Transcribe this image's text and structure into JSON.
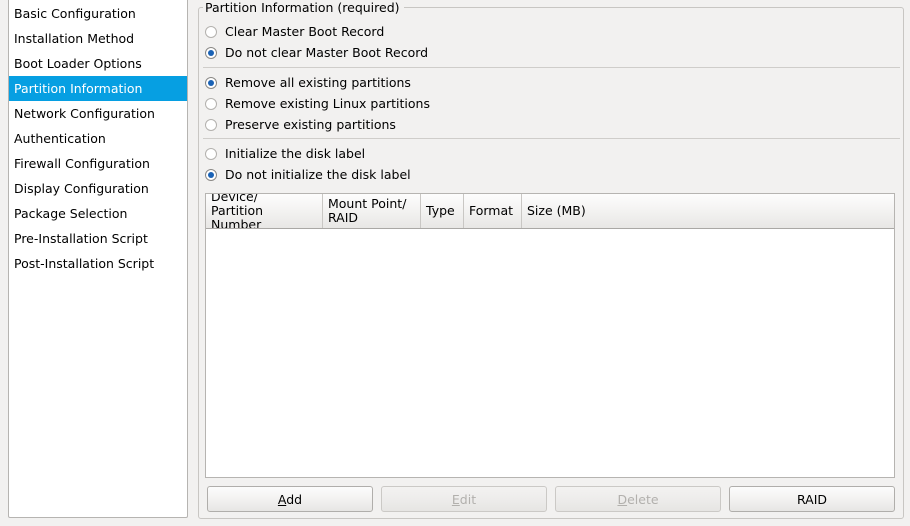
{
  "sidebar": {
    "items": [
      {
        "label": "Basic Configuration",
        "selected": false
      },
      {
        "label": "Installation Method",
        "selected": false
      },
      {
        "label": "Boot Loader Options",
        "selected": false
      },
      {
        "label": "Partition Information",
        "selected": true
      },
      {
        "label": "Network Configuration",
        "selected": false
      },
      {
        "label": "Authentication",
        "selected": false
      },
      {
        "label": "Firewall Configuration",
        "selected": false
      },
      {
        "label": "Display Configuration",
        "selected": false
      },
      {
        "label": "Package Selection",
        "selected": false
      },
      {
        "label": "Pre-Installation Script",
        "selected": false
      },
      {
        "label": "Post-Installation Script",
        "selected": false
      }
    ],
    "selected_color": "#069fe2"
  },
  "groupbox": {
    "legend": "Partition Information (required)"
  },
  "mbr_group": {
    "options": [
      {
        "label": "Clear Master Boot Record",
        "checked": false
      },
      {
        "label": "Do not clear Master Boot Record",
        "checked": true
      }
    ]
  },
  "partition_group": {
    "options": [
      {
        "label": "Remove all existing partitions",
        "checked": true
      },
      {
        "label": "Remove existing Linux partitions",
        "checked": false
      },
      {
        "label": "Preserve existing partitions",
        "checked": false
      }
    ]
  },
  "disklabel_group": {
    "options": [
      {
        "label": "Initialize the disk label",
        "checked": false
      },
      {
        "label": "Do not initialize the disk label",
        "checked": true
      }
    ]
  },
  "table": {
    "columns": [
      {
        "line1": "Device/",
        "line2": "Partition Number"
      },
      {
        "line1": "Mount Point/",
        "line2": "RAID"
      },
      {
        "line1": "Type",
        "line2": ""
      },
      {
        "line1": "Format",
        "line2": ""
      },
      {
        "line1": "Size (MB)",
        "line2": ""
      }
    ],
    "rows": []
  },
  "buttons": [
    {
      "pre": "",
      "mnemonic": "A",
      "post": "dd",
      "enabled": true
    },
    {
      "pre": "",
      "mnemonic": "E",
      "post": "dit",
      "enabled": false
    },
    {
      "pre": "",
      "mnemonic": "D",
      "post": "elete",
      "enabled": false
    },
    {
      "pre": "RAID",
      "mnemonic": "",
      "post": "",
      "enabled": true
    }
  ]
}
